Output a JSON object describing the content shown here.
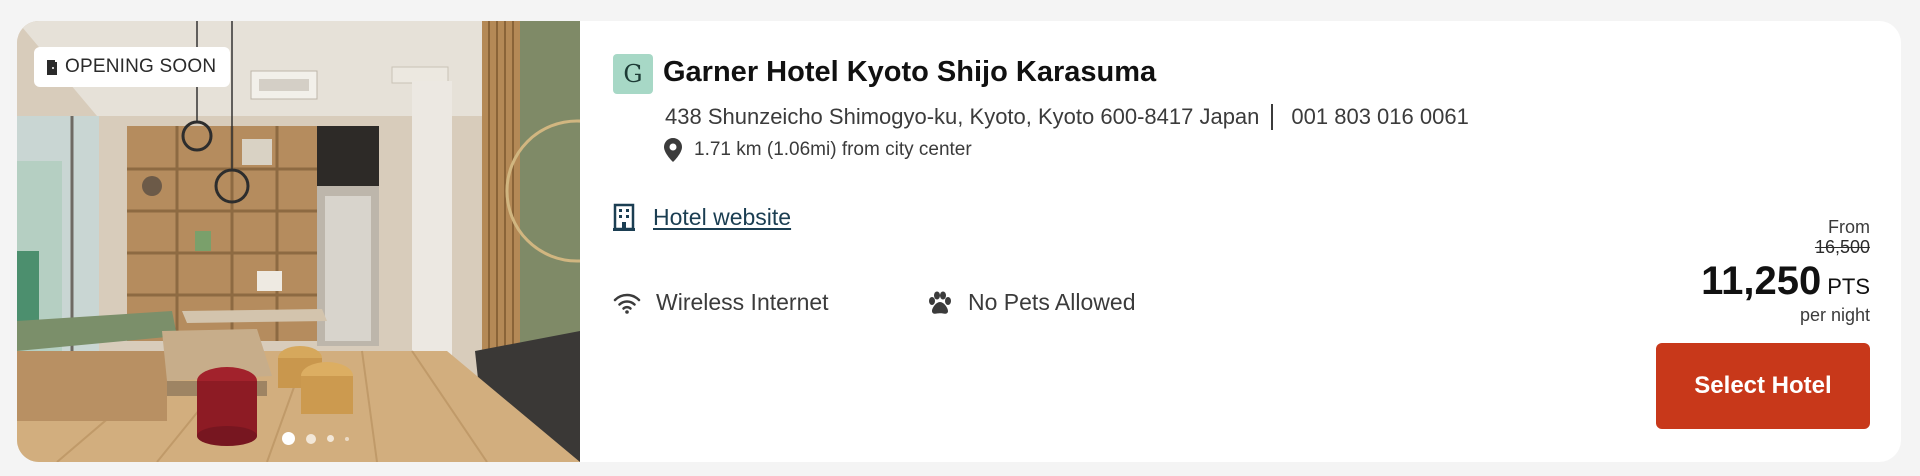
{
  "badge": {
    "label": "OPENING SOON",
    "icon": "door-icon"
  },
  "carousel": {
    "slide_count": 4,
    "active_index": 0
  },
  "hotel": {
    "brand_logo_letter": "G",
    "brand_logo_color": "#a7d8c6",
    "name": "Garner Hotel Kyoto Shijo Karasuma",
    "address": "438 Shunzeicho Shimogyo-ku, Kyoto, Kyoto 600-8417 Japan",
    "phone": "001 803 016 0061",
    "distance": "1.71 km (1.06mi) from city center",
    "website_label": "Hotel website"
  },
  "amenities": [
    {
      "icon": "wifi-icon",
      "label": "Wireless Internet"
    },
    {
      "icon": "paw-icon",
      "label": "No Pets Allowed"
    }
  ],
  "price": {
    "from_label": "From",
    "original": "16,500",
    "current": "11,250",
    "unit": "PTS",
    "per": "per night"
  },
  "actions": {
    "select_label": "Select Hotel",
    "button_color": "#c8381a"
  }
}
